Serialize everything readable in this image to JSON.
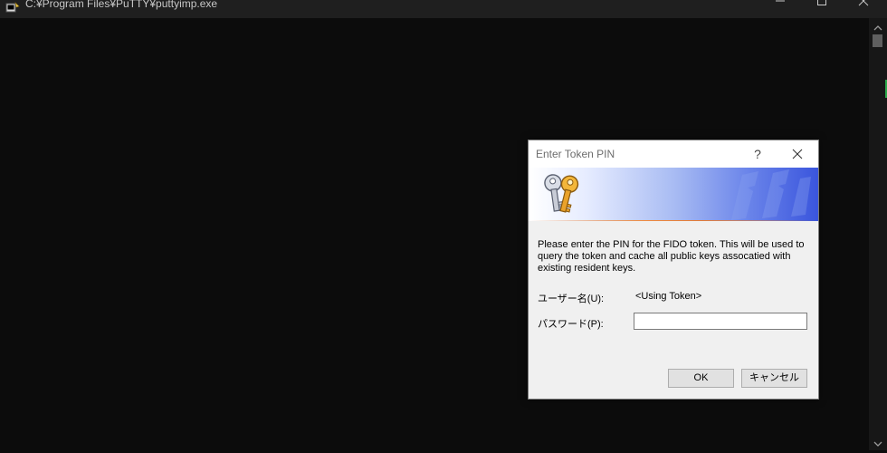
{
  "window": {
    "title": "C:¥Program Files¥PuTTY¥puttyimp.exe",
    "app_icon": "putty-icon",
    "controls": [
      "minimize-icon",
      "maximize-icon",
      "close-icon"
    ]
  },
  "dialog": {
    "title": "Enter Token PIN",
    "help_label": "?",
    "banner_icon": "keys-icon",
    "message": "Please enter the PIN for the FIDO token. This will be used to query the token and cache all public keys assocatied with existing resident keys.",
    "username_label": "ユーザー名(U):",
    "username_value": "<Using Token>",
    "password_label": "パスワード(P):",
    "password_value": "",
    "ok_label": "OK",
    "cancel_label": "キャンセル"
  },
  "colors": {
    "terminal_bg": "#0c0c0c",
    "titlebar_bg": "#1f1f1f",
    "dialog_bg": "#f0f0f0",
    "banner_blue": "#3a55dd",
    "banner_accent": "#f08a3c"
  }
}
